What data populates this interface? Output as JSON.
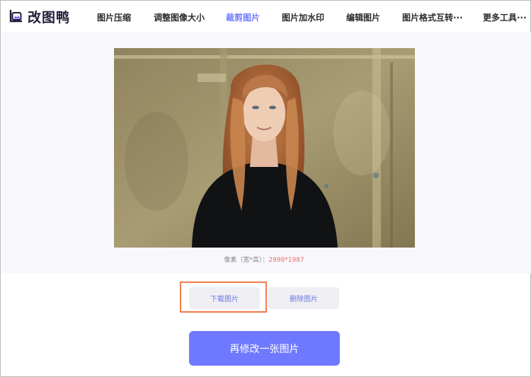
{
  "brand": {
    "name": "改图鸭",
    "accent": "#6e78ff"
  },
  "nav": {
    "items": [
      {
        "label": "图片压缩"
      },
      {
        "label": "调整图像大小"
      },
      {
        "label": "裁剪图片",
        "active": true
      },
      {
        "label": "图片加水印"
      },
      {
        "label": "编辑图片"
      },
      {
        "label": "图片格式互转···"
      },
      {
        "label": "更多工具···"
      }
    ]
  },
  "preview": {
    "dims_label": "像素（宽*高）：",
    "dims_value": "2998*1987"
  },
  "actions": {
    "download_label": "下载图片",
    "delete_label": "删除图片",
    "modify_another_label": "再修改一张图片"
  },
  "colors": {
    "highlight_outline": "#f07a4a",
    "primary_button": "#6f79ff",
    "dims_value": "#ec6b6b"
  }
}
